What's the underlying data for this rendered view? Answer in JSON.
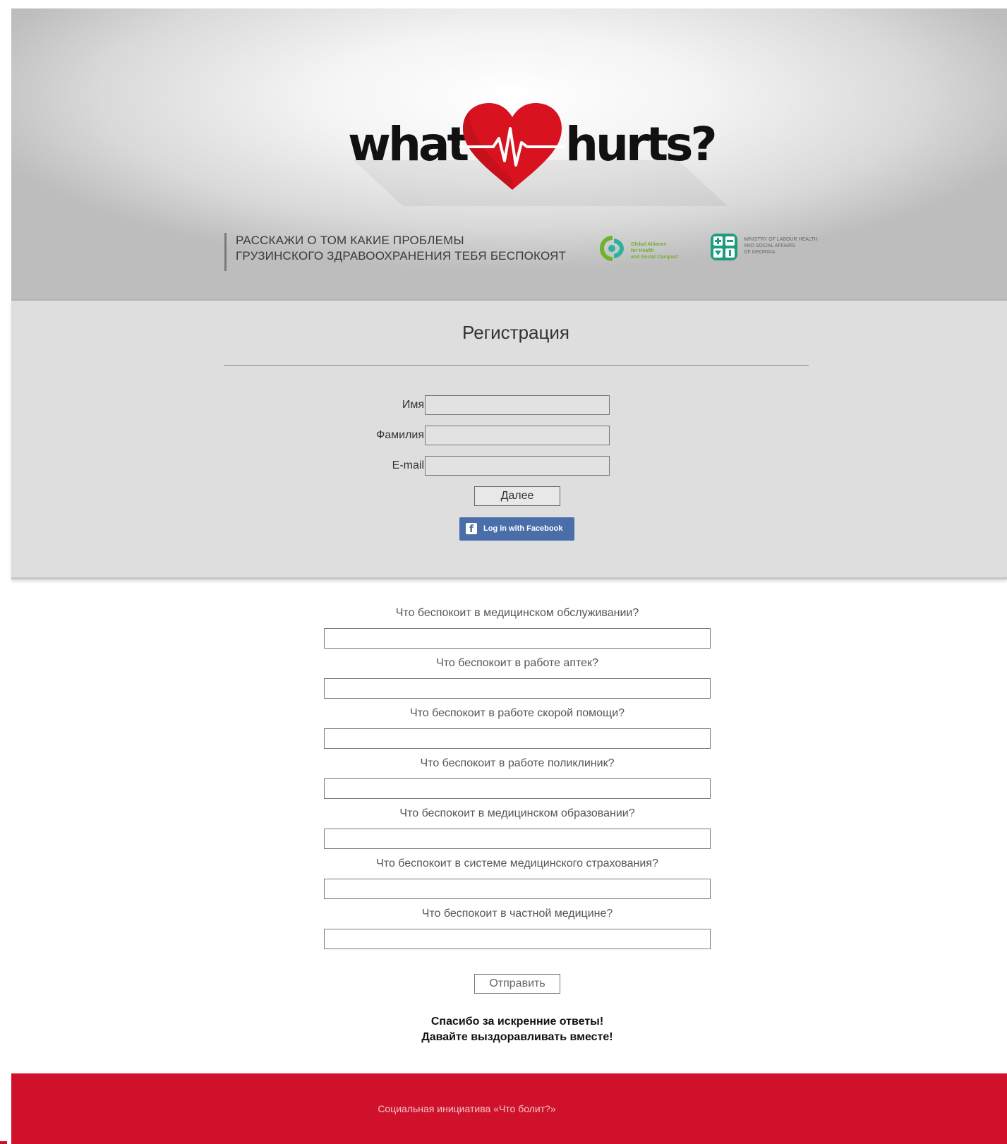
{
  "colors": {
    "brand_red": "#d0112b",
    "facebook_blue": "#4a6ea9",
    "partner_green": "#6fb22b"
  },
  "header": {
    "logo": {
      "word_left": "what",
      "word_right": "hurts?",
      "heart_icon": "heart-pulse-icon"
    },
    "tagline": {
      "line1": "РАССКАЖИ О ТОМ КАКИЕ ПРОБЛЕМЫ",
      "line2": "ГРУЗИНСКОГО ЗДРАВООХРАНЕНИЯ ТЕБЯ БЕСПОКОЯТ"
    },
    "partners": [
      {
        "icon": "global-alliance-logo-icon",
        "lines": [
          "Global Alliance",
          "for Health",
          "and Social Compact"
        ]
      },
      {
        "icon": "ministry-logo-icon",
        "lines": [
          "MINISTRY OF LABOUR HEALTH",
          "AND SOCIAL AFFAIRS",
          "OF GEORGIA"
        ]
      }
    ]
  },
  "registration": {
    "title": "Регистрация",
    "fields": [
      {
        "label": "Имя",
        "value": "",
        "placeholder": ""
      },
      {
        "label": "Фамилия",
        "value": "",
        "placeholder": ""
      },
      {
        "label": "E-mail",
        "value": "",
        "placeholder": ""
      }
    ],
    "next_label": "Далее",
    "facebook_label": "Log in with Facebook",
    "facebook_icon": "facebook-icon"
  },
  "questions": {
    "items": [
      {
        "label": "Что  беспокоит в медицинском обслуживании?",
        "value": ""
      },
      {
        "label": "Что беспокоит в работе аптек?",
        "value": ""
      },
      {
        "label": "Что беспокоит в работе скорой помощи?",
        "value": ""
      },
      {
        "label": "Что беспокоит в работе поликлиник?",
        "value": ""
      },
      {
        "label": "Что беспокоит в медицинском образовании?",
        "value": ""
      },
      {
        "label": "Что беспокоит в системе медицинского страхования?",
        "value": ""
      },
      {
        "label": "Что беспокоит в частной медицине?",
        "value": ""
      }
    ],
    "submit_label": "Отправить",
    "thanks_line1": "Спасибо за искренние ответы!",
    "thanks_line2": "Давайте выздоравливать вместе!"
  },
  "footer": {
    "text": "Социальная инициатива «Что болит?»"
  }
}
